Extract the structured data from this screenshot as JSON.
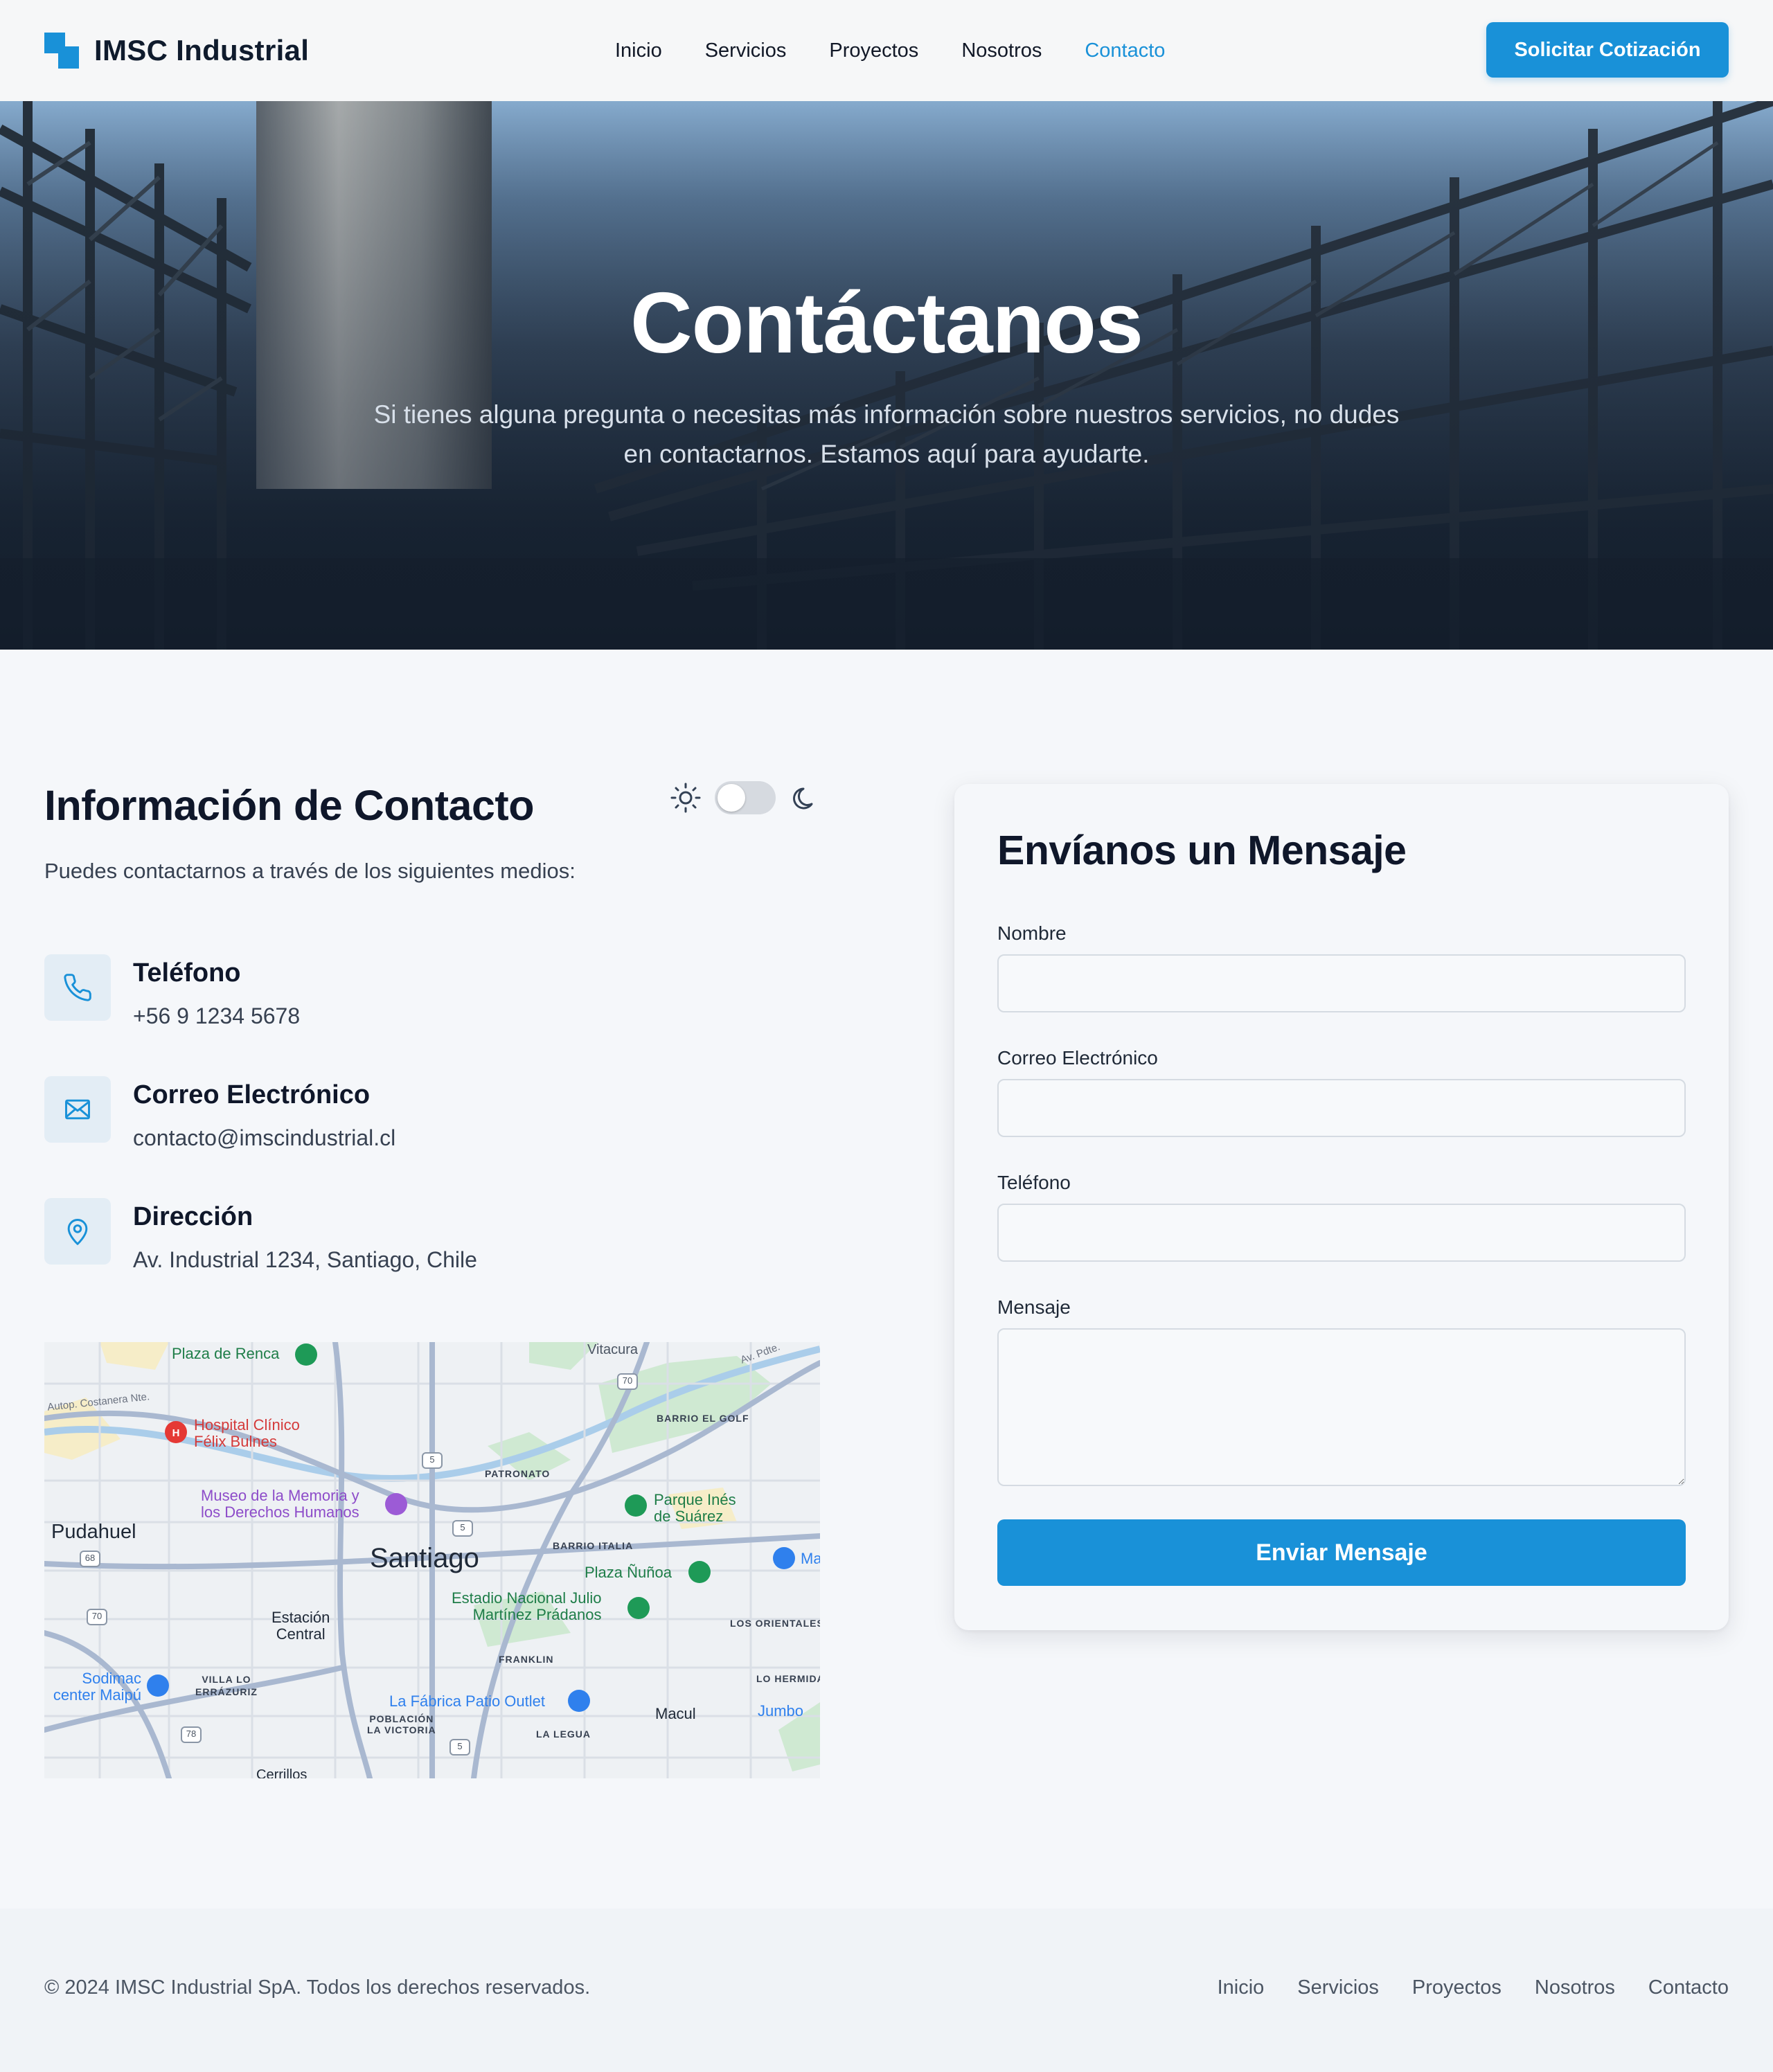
{
  "nav": {
    "brand": "IMSC Industrial",
    "links": [
      {
        "label": "Inicio"
      },
      {
        "label": "Servicios"
      },
      {
        "label": "Proyectos"
      },
      {
        "label": "Nosotros"
      },
      {
        "label": "Contacto",
        "active": true
      }
    ],
    "cta": "Solicitar Cotización"
  },
  "hero": {
    "title": "Contáctanos",
    "subtitle": "Si tienes alguna pregunta o necesitas más información sobre nuestros servicios, no dudes en contactarnos. Estamos aquí para ayudarte."
  },
  "info": {
    "title": "Información de Contacto",
    "subtitle": "Puedes contactarnos a través de los siguientes medios:",
    "items": [
      {
        "label": "Teléfono",
        "value": "+56 9 1234 5678",
        "icon": "phone-icon"
      },
      {
        "label": "Correo Electrónico",
        "value": "contacto@imscindustrial.cl",
        "icon": "mail-icon"
      },
      {
        "label": "Dirección",
        "value": "Av. Industrial 1234, Santiago, Chile",
        "icon": "map-pin-icon"
      }
    ],
    "theme_toggle": {
      "state": "light"
    }
  },
  "map": {
    "labels": {
      "plaza_renca": "Plaza de Renca",
      "vitacura": "Vitacura",
      "costanera": "Autop. Costanera Nte.",
      "av_pdte": "Av. Pdte.",
      "hospital_1": "Hospital Clínico",
      "hospital_2": "Félix Bulnes",
      "golf": "BARRIO EL GOLF",
      "patronato": "PATRONATO",
      "museo_1": "Museo de la Memoria y",
      "museo_2": "los Derechos Humanos",
      "parque_1": "Parque Inés",
      "parque_2": "de Suárez",
      "pudahuel": "Pudahuel",
      "santiago": "Santiago",
      "italia": "BARRIO ITALIA",
      "plaza_nunoa": "Plaza Ñuñoa",
      "ma": "Ma",
      "estadio_1": "Estadio Nacional Julio",
      "estadio_2": "Martínez Prádanos",
      "estacion_1": "Estación",
      "estacion_2": "Central",
      "orientales": "LOS ORIENTALES",
      "franklin": "FRANKLIN",
      "sodimac_1": "Sodimac",
      "sodimac_2": "center Maipú",
      "villa_1": "VILLA LO",
      "villa_2": "ERRÁZURIZ",
      "hermida": "LO HERMIDA",
      "fabrica": "La Fábrica Patio Outlet",
      "poblacion_1": "POBLACIÓN",
      "poblacion_2": "LA VICTORIA",
      "macul": "Macul",
      "jumbo": "Jumbo",
      "legua": "LA LEGUA",
      "cerrillos": "Cerrillos",
      "r70a": "70",
      "r5a": "5",
      "r5b": "5",
      "r68": "68",
      "r70b": "70",
      "r78": "78",
      "r5c": "5"
    }
  },
  "form": {
    "title": "Envíanos un Mensaje",
    "fields": [
      {
        "label": "Nombre",
        "value": ""
      },
      {
        "label": "Correo Electrónico",
        "value": ""
      },
      {
        "label": "Teléfono",
        "value": ""
      },
      {
        "label": "Mensaje",
        "value": ""
      }
    ],
    "submit": "Enviar Mensaje"
  },
  "footer": {
    "copyright": "© 2024 IMSC Industrial SpA. Todos los derechos reservados.",
    "links": [
      {
        "label": "Inicio"
      },
      {
        "label": "Servicios"
      },
      {
        "label": "Proyectos"
      },
      {
        "label": "Nosotros"
      },
      {
        "label": "Contacto"
      }
    ]
  },
  "colors": {
    "accent": "#1991d8",
    "text": "#0f172a",
    "muted": "#374151",
    "background": "#f5f7fa"
  }
}
